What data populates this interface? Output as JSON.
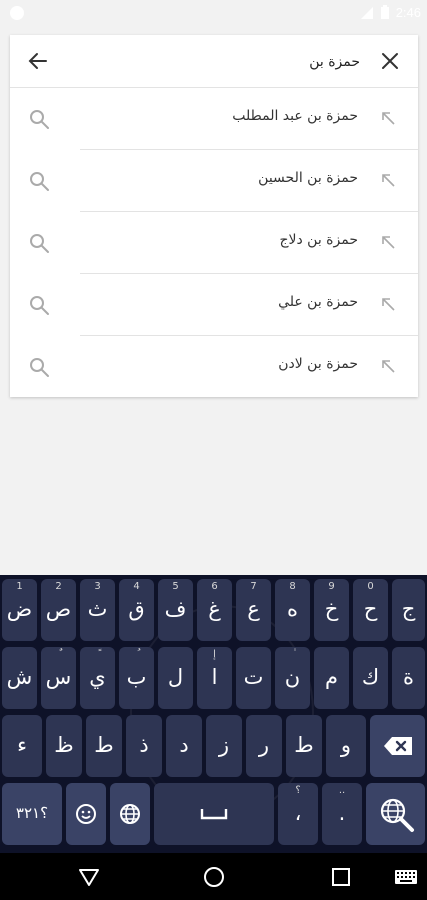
{
  "status_bar": {
    "time": "2:46",
    "icons": [
      "circle-icon",
      "signal-icon",
      "battery-icon"
    ]
  },
  "search": {
    "query": "حمزة بن",
    "back_icon": "arrow-left-icon",
    "clear_icon": "close-icon"
  },
  "suggestions": [
    {
      "label": "حمزة بن عبد المطلب"
    },
    {
      "label": "حمزة بن الحسين"
    },
    {
      "label": "حمزة بن دلاج"
    },
    {
      "label": "حمزة بن علي"
    },
    {
      "label": "حمزة بن لادن"
    }
  ],
  "keyboard": {
    "row1": [
      {
        "main": "ض",
        "hint": "1"
      },
      {
        "main": "ص",
        "hint": "2"
      },
      {
        "main": "ث",
        "hint": "3"
      },
      {
        "main": "ق",
        "hint": "4"
      },
      {
        "main": "ف",
        "hint": "5"
      },
      {
        "main": "غ",
        "hint": "6"
      },
      {
        "main": "ع",
        "hint": "7"
      },
      {
        "main": "ه",
        "hint": "8"
      },
      {
        "main": "خ",
        "hint": "9"
      },
      {
        "main": "ح",
        "hint": "0"
      },
      {
        "main": "ج",
        "hint": ""
      }
    ],
    "row2": [
      {
        "main": "ش",
        "hint": ""
      },
      {
        "main": "س",
        "hint": "ٌ"
      },
      {
        "main": "ي",
        "hint": "ً"
      },
      {
        "main": "ب",
        "hint": "ُ"
      },
      {
        "main": "ل",
        "hint": ""
      },
      {
        "main": "ا",
        "hint": "إ"
      },
      {
        "main": "ت",
        "hint": ""
      },
      {
        "main": "ن",
        "hint": "ٰ"
      },
      {
        "main": "م",
        "hint": ""
      },
      {
        "main": "ك",
        "hint": ""
      },
      {
        "main": "ة",
        "hint": ""
      }
    ],
    "row3": [
      {
        "main": "ء",
        "hint": ""
      },
      {
        "main": "ظ",
        "hint": ""
      },
      {
        "main": "ط",
        "hint": ""
      },
      {
        "main": "ذ",
        "hint": ""
      },
      {
        "main": "د",
        "hint": ""
      },
      {
        "main": "ز",
        "hint": ""
      },
      {
        "main": "ر",
        "hint": ""
      },
      {
        "main": "ط",
        "hint": ""
      },
      {
        "main": "و",
        "hint": ""
      }
    ],
    "row4": {
      "numbers_label": "؟٣٢١",
      "comma_hint": "؟",
      "comma_main": "،",
      "period_hint": "..",
      "period_main": "."
    },
    "colors": {
      "bg": "#0e1228",
      "key": "#2e3553"
    }
  },
  "nav": {
    "back_icon": "triangle-back-icon",
    "home_icon": "circle-home-icon",
    "recents_icon": "square-recents-icon",
    "keyboard_icon": "keyboard-icon"
  }
}
